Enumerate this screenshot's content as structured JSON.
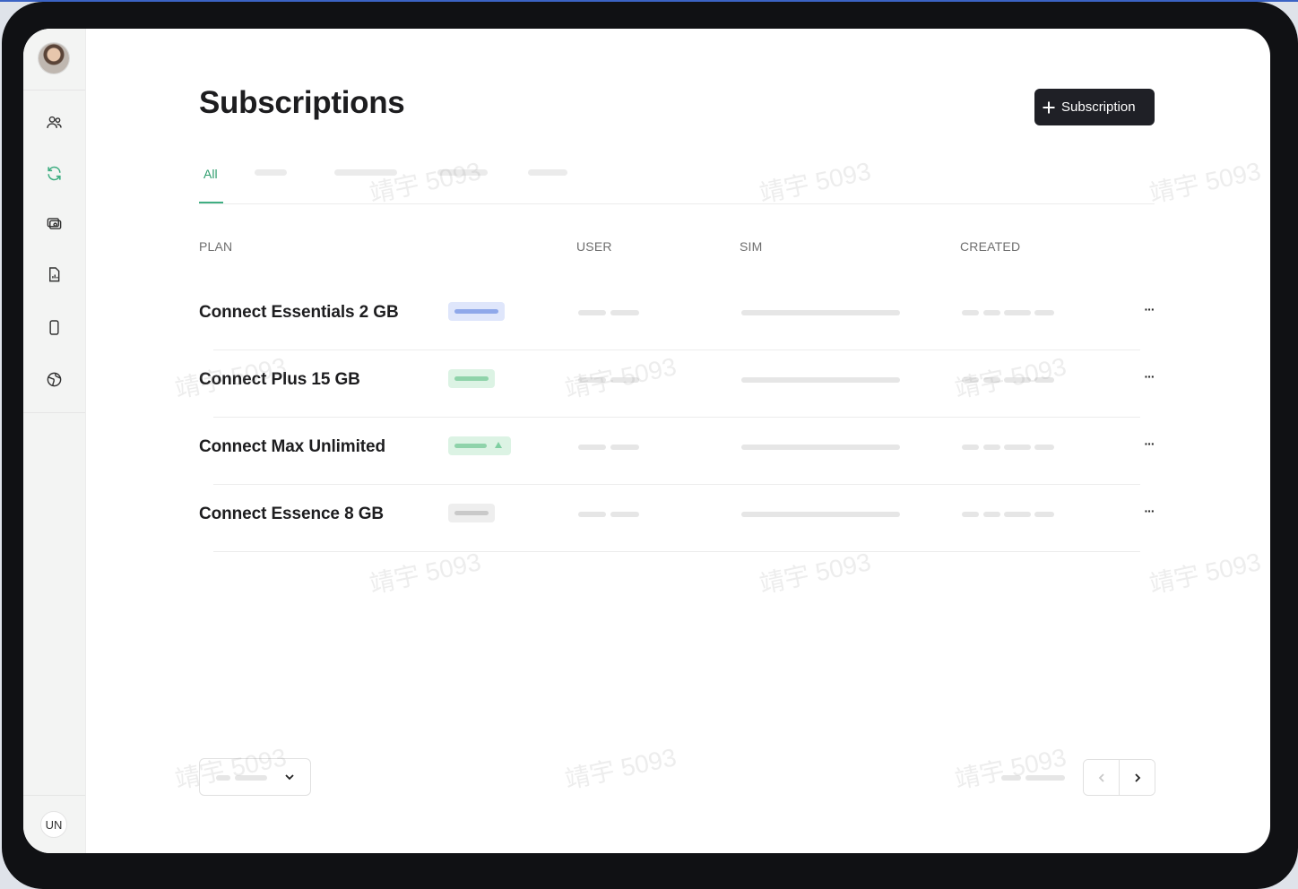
{
  "page": {
    "title": "Subscriptions",
    "add_button_label": "Subscription"
  },
  "user": {
    "initials": "UN"
  },
  "sidebar": {
    "items": [
      {
        "icon": "users-icon",
        "active": false
      },
      {
        "icon": "refresh-icon",
        "active": true
      },
      {
        "icon": "payment-icon",
        "active": false
      },
      {
        "icon": "report-icon",
        "active": false
      },
      {
        "icon": "device-icon",
        "active": false
      },
      {
        "icon": "globe-icon",
        "active": false
      }
    ]
  },
  "tabs": {
    "active_label": "All"
  },
  "table": {
    "columns": [
      "PLAN",
      "USER",
      "SIM",
      "CREATED"
    ],
    "rows": [
      {
        "plan": "Connect Essentials 2 GB",
        "badge_color": "#dfe6fb",
        "badge_accent": "#8fa8ea"
      },
      {
        "plan": "Connect Plus 15 GB",
        "badge_color": "#dcf3e4",
        "badge_accent": "#8fd3aa"
      },
      {
        "plan": "Connect Max Unlimited",
        "badge_color": "#dcf3e4",
        "badge_accent": "#8fd3aa"
      },
      {
        "plan": "Connect Essence 8 GB",
        "badge_color": "#eeeeee",
        "badge_accent": "#c9c9c9"
      }
    ],
    "row_action_label": "···"
  },
  "colors": {
    "accent": "#3fae82",
    "button_bg": "#1f2026"
  },
  "watermark_text": "靖宇 5093"
}
